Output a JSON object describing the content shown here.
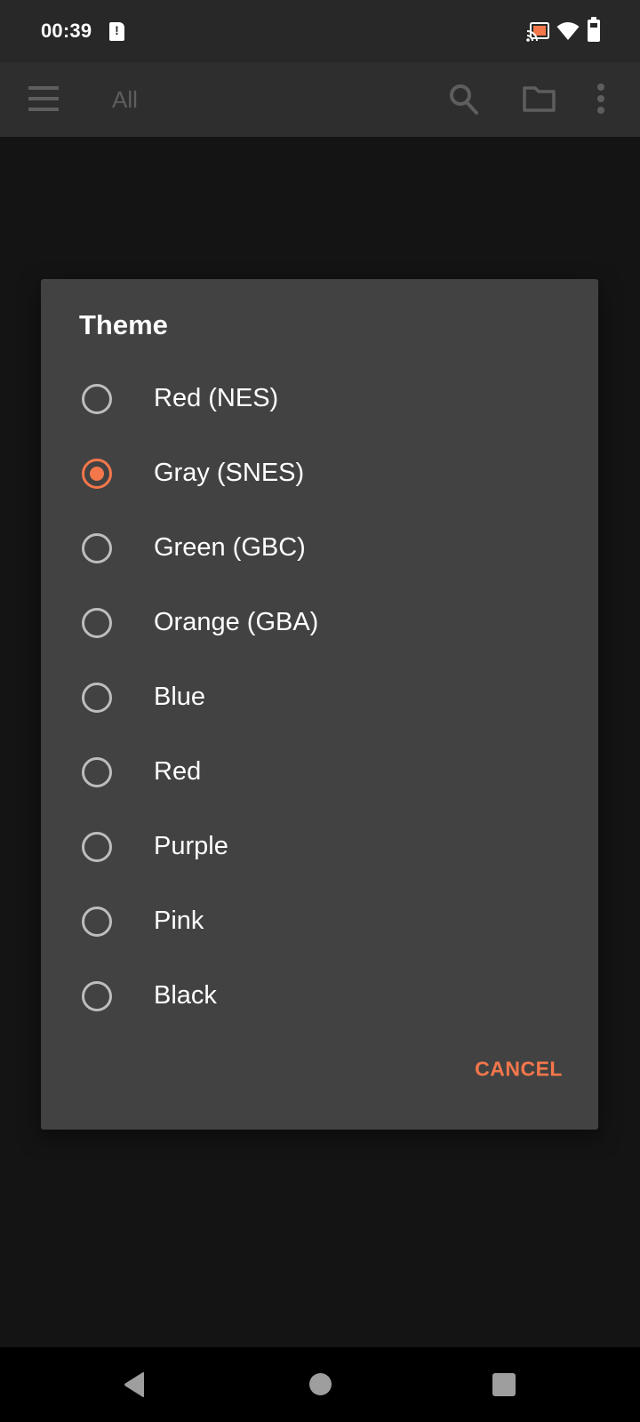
{
  "status_bar": {
    "time": "00:39",
    "icons": [
      "sim-alert-icon",
      "cast-icon",
      "wifi-icon",
      "battery-icon"
    ],
    "cast_color": "#f4774b"
  },
  "app_bar": {
    "title": "All",
    "icons": [
      "menu-icon",
      "search-icon",
      "folder-icon",
      "more-vert-icon"
    ]
  },
  "dialog": {
    "title": "Theme",
    "options": [
      {
        "label": "Red (NES)",
        "selected": false
      },
      {
        "label": "Gray (SNES)",
        "selected": true
      },
      {
        "label": "Green (GBC)",
        "selected": false
      },
      {
        "label": "Orange (GBA)",
        "selected": false
      },
      {
        "label": "Blue",
        "selected": false
      },
      {
        "label": "Red",
        "selected": false
      },
      {
        "label": "Purple",
        "selected": false
      },
      {
        "label": "Pink",
        "selected": false
      },
      {
        "label": "Black",
        "selected": false
      }
    ],
    "selected_value": "Gray (SNES)",
    "cancel_label": "CANCEL",
    "accent_color": "#f4774b"
  },
  "nav_bar": {
    "icons": [
      "back-icon",
      "home-icon",
      "recents-icon"
    ]
  }
}
